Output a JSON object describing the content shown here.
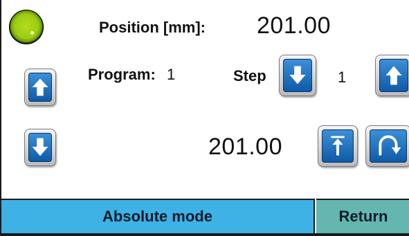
{
  "status": {
    "indicator_color": "#9ccc14",
    "indicator_icon": "status-lamp-icon"
  },
  "position": {
    "label": "Position  [mm]:",
    "value": "201.00"
  },
  "program": {
    "label": "Program:",
    "value": "1"
  },
  "step": {
    "label": "Step",
    "value": "1"
  },
  "target": {
    "value": "201.00"
  },
  "buttons": {
    "program_up_icon": "arrow-up-icon",
    "program_down_icon": "arrow-down-icon",
    "step_down_icon": "arrow-down-icon",
    "step_up_icon": "arrow-up-icon",
    "move_to_position_icon": "move-to-top-icon",
    "cycle_icon": "cycle-icon"
  },
  "bottom_bar": {
    "mode_label": "Absolute mode",
    "return_label": "Return",
    "mode_color": "#3eb1e5",
    "return_color": "#63b7b0"
  },
  "colors": {
    "button_blue": "#1c6fc2"
  }
}
